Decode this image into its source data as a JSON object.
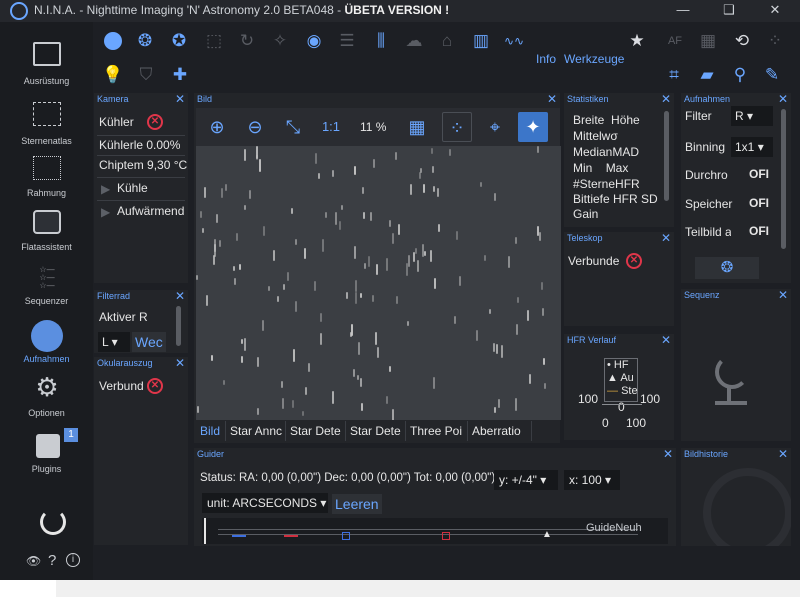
{
  "window": {
    "title": "N.I.N.A. - Nighttime Imaging 'N' Astronomy 2.0 BETA048 - ",
    "beta_label": "ÜBETA VERSION !",
    "minimize": "—",
    "maximize": "❑",
    "close": "✕"
  },
  "nav": {
    "items": [
      {
        "label": "Ausrüstung",
        "icon": "telescope-icon"
      },
      {
        "label": "Sternenatlas",
        "icon": "star-map-icon"
      },
      {
        "label": "Rahmung",
        "icon": "framing-icon"
      },
      {
        "label": "Flatassistent",
        "icon": "flat-wizard-icon"
      },
      {
        "label": "Sequenzer",
        "icon": "sequencer-icon"
      },
      {
        "label": "Aufnahmen",
        "icon": "imaging-icon",
        "active": true
      },
      {
        "label": "Optionen",
        "icon": "gears-icon"
      },
      {
        "label": "Plugins",
        "icon": "puzzle-icon",
        "badge": "1"
      }
    ],
    "bottom_icons": [
      "power-icon",
      "eye-icon",
      "help-icon",
      "info-icon"
    ]
  },
  "toolbar": {
    "info_label": "Info",
    "tools_label": "Werkzeuge"
  },
  "panels": {
    "camera": {
      "title": "Kamera",
      "rows": [
        "Kühler",
        "Kühlerle 0.00%",
        "Chiptem 9,30 °C"
      ],
      "buttons": [
        "Kühle",
        "Aufwärmend"
      ]
    },
    "filterwheel": {
      "title": "Filterrad",
      "active_label": "Aktiver R",
      "select_value": "L",
      "change_button": "Wec"
    },
    "focuser": {
      "title": "Okularauszug",
      "status": "Verbund"
    },
    "image": {
      "title": "Bild",
      "zoom_1to1": "1:1",
      "zoom_percent": "11 %",
      "tabs": [
        "Bild",
        "Star Annc",
        "Star Dete",
        "Star Dete",
        "Three Poi",
        "Aberratio"
      ]
    },
    "statistics": {
      "title": "Statistiken",
      "rows": [
        [
          "Breite",
          "Höhe"
        ],
        [
          "Mittelwσ",
          ""
        ],
        [
          "MedianMAD",
          ""
        ],
        [
          "Min",
          "Max"
        ],
        [
          "#SterneHFR",
          ""
        ],
        [
          "Bittiefe HFR SD",
          ""
        ],
        [
          "Gain",
          ""
        ]
      ]
    },
    "telescope": {
      "title": "Teleskop",
      "status": "Verbunde"
    },
    "hfr": {
      "title": "HFR Verlauf",
      "legend": [
        "HF",
        "Au",
        "Ste"
      ],
      "y_left": "100",
      "y_mid": "0",
      "y_right": "100",
      "x_left": "0",
      "x_right": "100"
    },
    "imaging": {
      "title": "Aufnahmen",
      "rows": [
        {
          "label": "Filter",
          "value": "R"
        },
        {
          "label": "Binning",
          "value": "1x1"
        },
        {
          "label": "Durchro",
          "value": "OFI"
        },
        {
          "label": "Speicher",
          "value": "OFI"
        },
        {
          "label": "Teilbild a",
          "value": "OFI"
        }
      ]
    },
    "sequence": {
      "title": "Sequenz"
    },
    "history": {
      "title": "Bildhistorie"
    },
    "guider": {
      "title": "Guider",
      "status": "Status:  RA: 0,00 (0,00\")  Dec: 0,00 (0,00\")  Tot: 0,00 (0,00\")",
      "y_scale": "y: +/-4\"",
      "x_scale": "x: 100",
      "unit": "unit: ARCSECONDS",
      "clear_button": "Leeren",
      "chart_label": "GuideNeuh"
    }
  },
  "colors": {
    "accent": "#6aa6ff",
    "error": "#e0364a",
    "panel": "#232529",
    "background": "#1d1f24"
  }
}
